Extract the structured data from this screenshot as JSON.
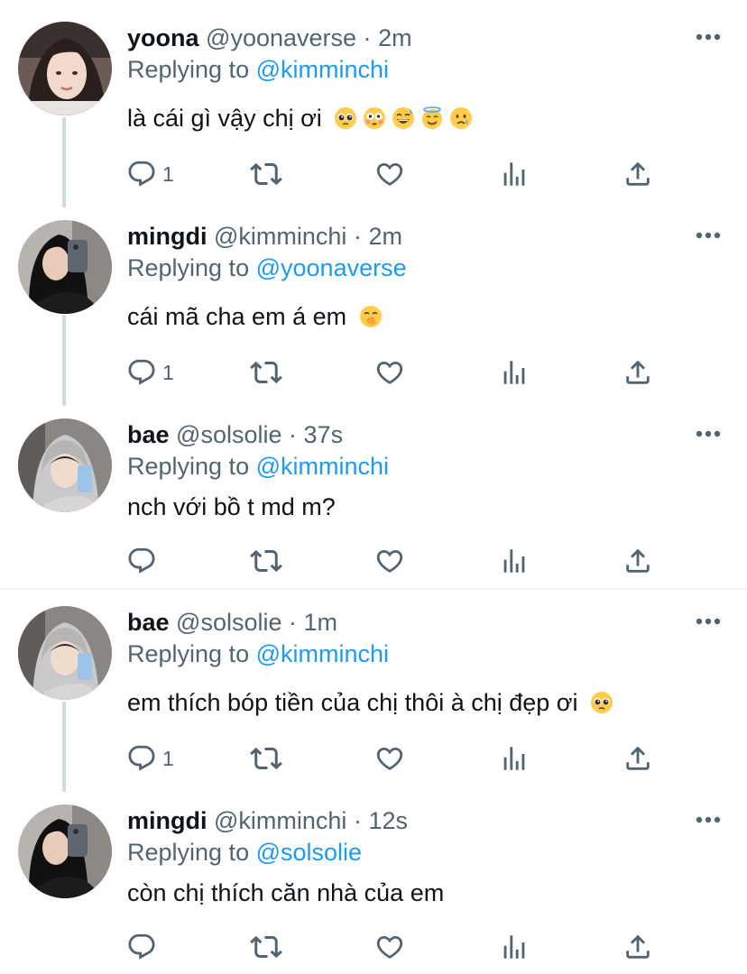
{
  "tweets": [
    {
      "name": "yoona",
      "handle": "@yoonaverse",
      "dot": "·",
      "time": "2m",
      "reply_prefix": "Replying to",
      "reply_to": "@kimminchi",
      "text": "là cái gì vậy chị ơi",
      "emojis": [
        "pleading-face-emoji",
        "flushed-face-emoji",
        "grinning-sweat-emoji",
        "smiling-halo-emoji",
        "crying-face-emoji"
      ],
      "reply_count": "1"
    },
    {
      "name": "mingdi",
      "handle": "@kimminchi",
      "dot": "·",
      "time": "2m",
      "reply_prefix": "Replying to",
      "reply_to": "@yoonaverse",
      "text": "cái mã cha em á em",
      "emojis": [
        "hand-over-mouth-emoji"
      ],
      "reply_count": "1"
    },
    {
      "name": "bae",
      "handle": "@solsolie",
      "dot": "·",
      "time": "37s",
      "reply_prefix": "Replying to",
      "reply_to": "@kimminchi",
      "text": "nch với bồ t md m?",
      "emojis": [],
      "reply_count": ""
    },
    {
      "name": "bae",
      "handle": "@solsolie",
      "dot": "·",
      "time": "1m",
      "reply_prefix": "Replying to",
      "reply_to": "@kimminchi",
      "text": "em thích bóp tiền của chị thôi à chị đẹp ơi",
      "emojis": [
        "pleading-face-emoji"
      ],
      "reply_count": "1"
    },
    {
      "name": "mingdi",
      "handle": "@kimminchi",
      "dot": "·",
      "time": "12s",
      "reply_prefix": "Replying to",
      "reply_to": "@solsolie",
      "text": "còn chị thích căn nhà của em",
      "emojis": [],
      "reply_count": ""
    }
  ],
  "icons": {
    "reply": "reply-icon",
    "retweet": "retweet-icon",
    "like": "heart-icon",
    "views": "views-icon",
    "share": "share-icon",
    "more": "more-icon"
  },
  "colors": {
    "text": "#0f1419",
    "muted": "#536471",
    "link": "#1d9bf0",
    "thread": "#cfd9de",
    "divider": "#eff3f4"
  }
}
